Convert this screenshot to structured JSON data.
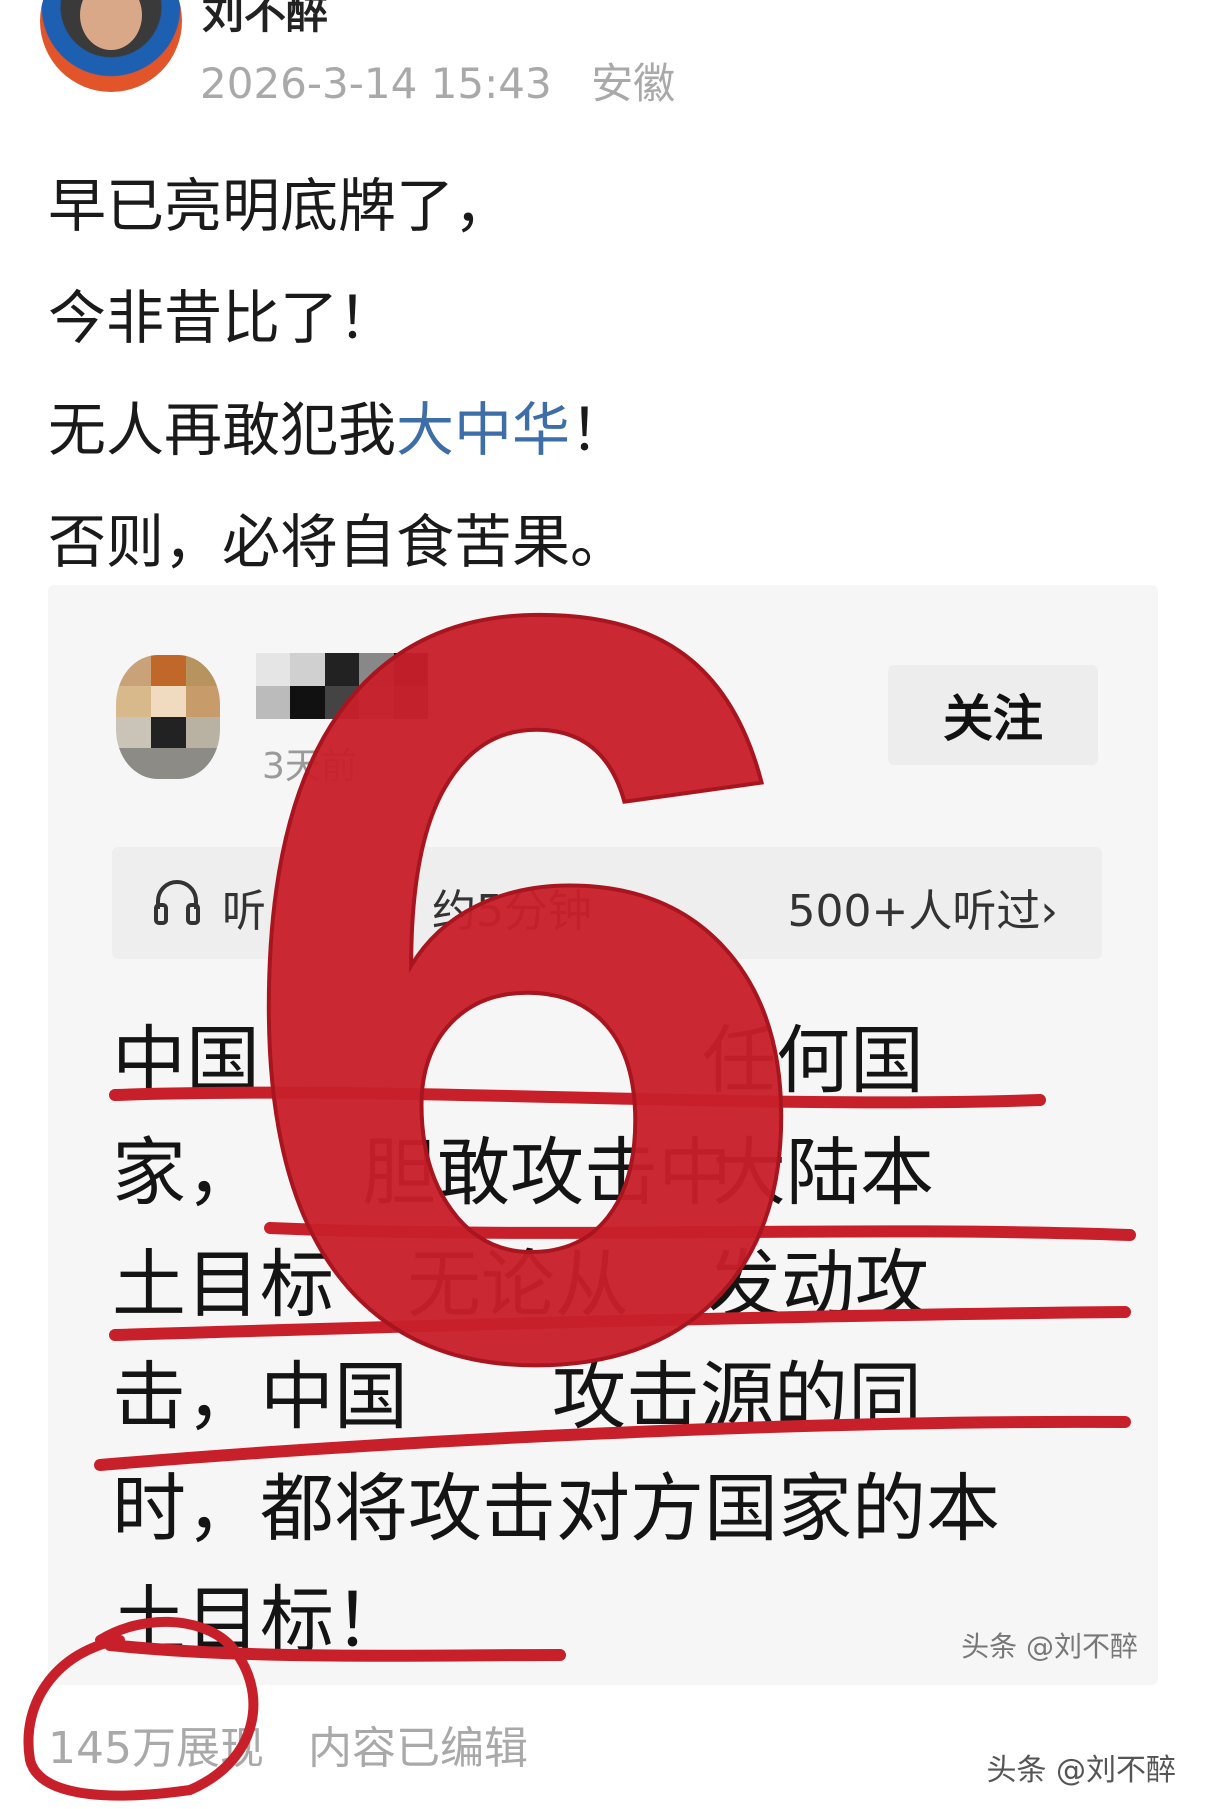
{
  "author": {
    "name": "刘不醉",
    "date": "2026-3-14 15:43",
    "location": "安徽"
  },
  "post": {
    "line1": "早已亮明底牌了，",
    "line2": "今非昔比了！",
    "line3_pre": "无人再敢犯我",
    "line3_link": "大中华",
    "line3_post": "！",
    "line4": "否则，必将自食苦果。"
  },
  "card": {
    "time": "3天前",
    "follow_label": "关注",
    "listen_label": "听",
    "duration": "约5分钟",
    "listeners": "500+人听过",
    "chevron": "›",
    "body_lines": [
      "中国",
      "家，",
      "土目标",
      "击，中国",
      "时，都将攻击对方国家的本",
      "土目标！"
    ],
    "body_fragments": {
      "l1_right": "任何国",
      "l2_mid": "胆敢攻击中",
      "l2_right": "大陆本",
      "l3_mid": "无论从",
      "l3_right": "发动攻",
      "l4_right": "攻击源的同"
    },
    "watermark": "头条 @刘不醉"
  },
  "overlay": {
    "big_number": "6",
    "accent": "#c8202b"
  },
  "footer": {
    "views": "145万展现",
    "edited": "内容已编辑"
  },
  "watermark": "头条 @刘不醉",
  "colors": {
    "link": "#3d6ea8",
    "meta": "#a9a9a9",
    "mark": "#c8202b"
  }
}
